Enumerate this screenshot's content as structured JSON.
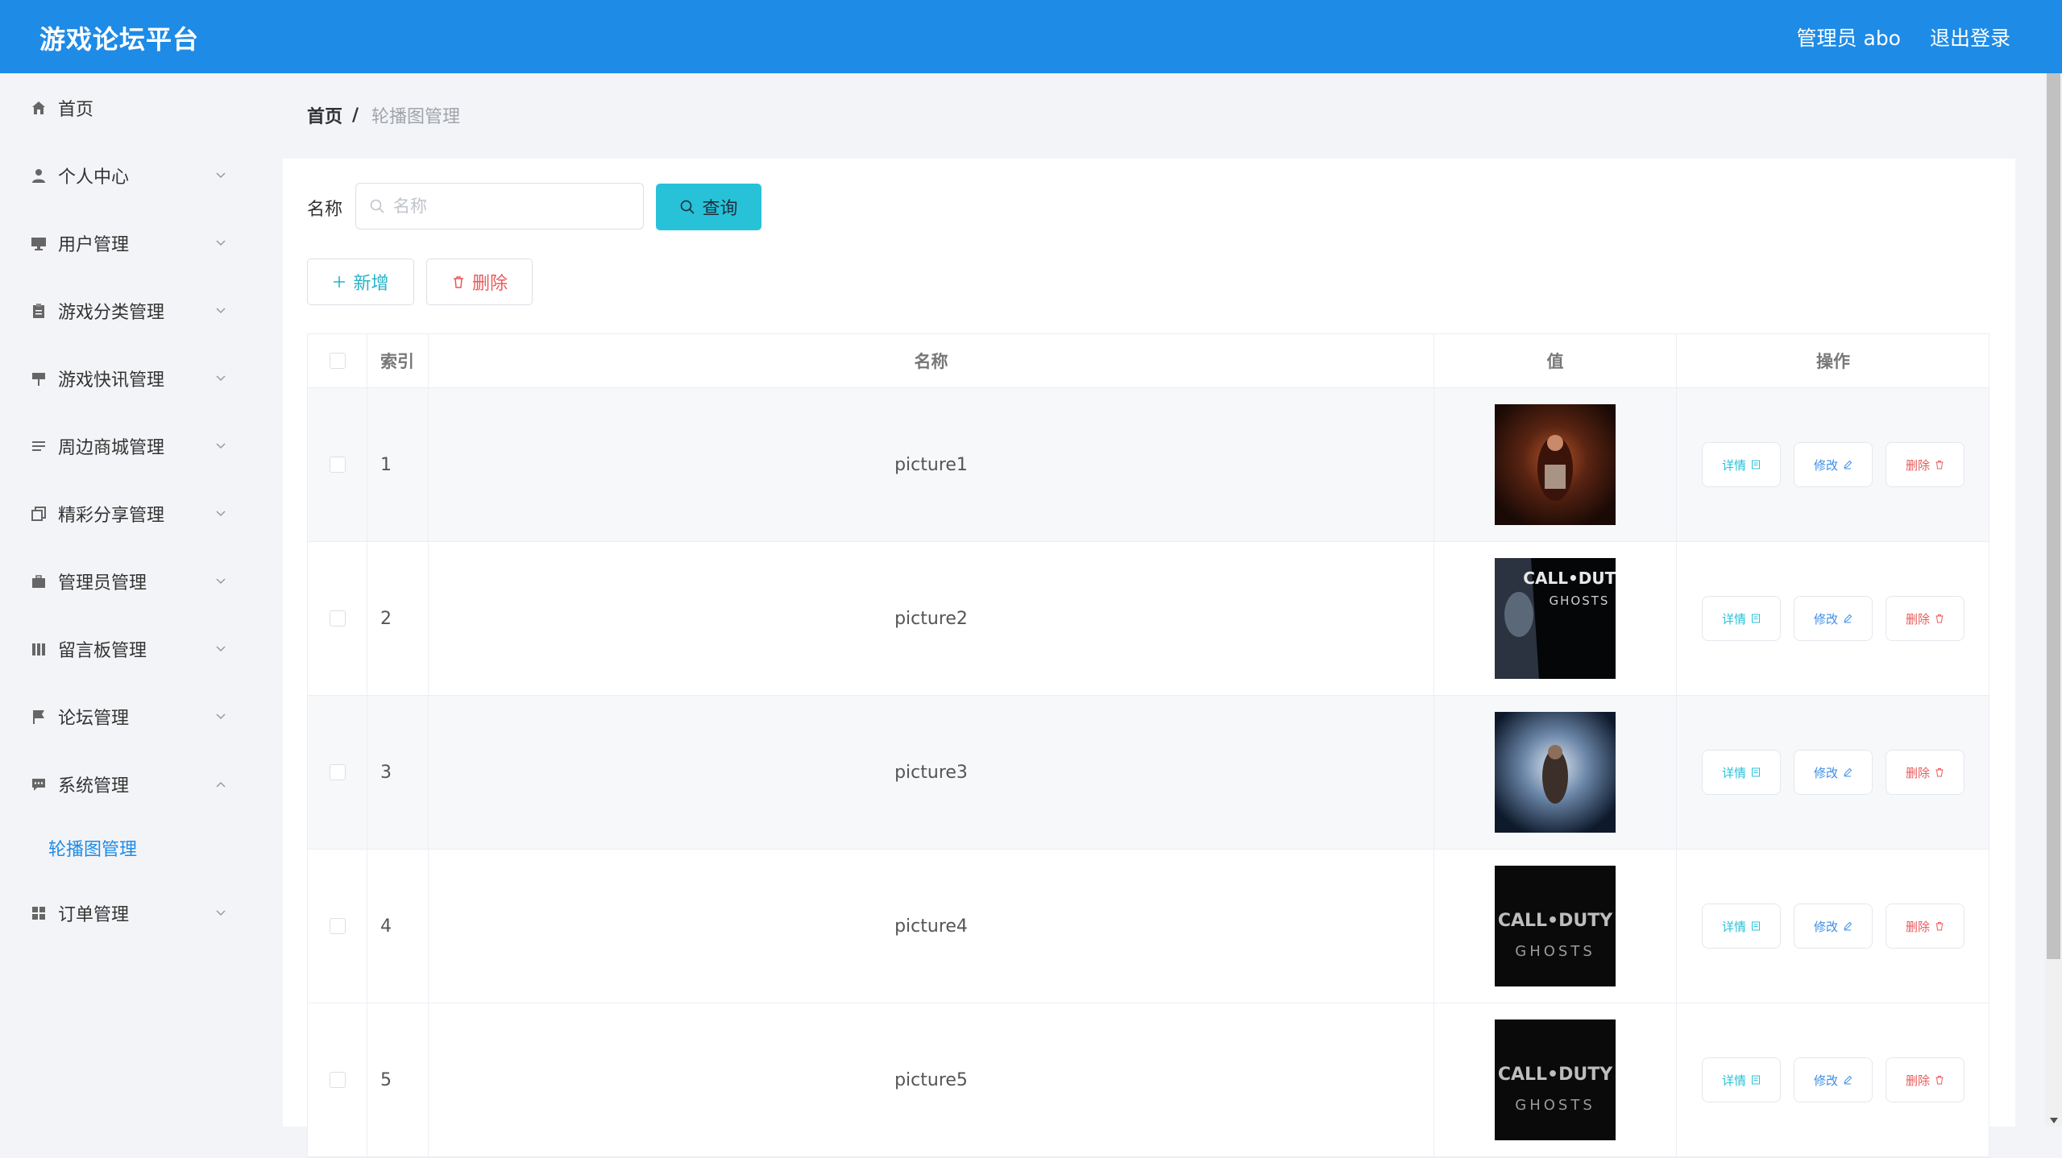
{
  "app": {
    "title": "游戏论坛平台",
    "user_label": "管理员 abo",
    "logout_label": "退出登录"
  },
  "sidebar": {
    "items": [
      {
        "label": "首页",
        "icon": "home-icon"
      },
      {
        "label": "个人中心",
        "icon": "user-icon"
      },
      {
        "label": "用户管理",
        "icon": "monitor-icon"
      },
      {
        "label": "游戏分类管理",
        "icon": "clipboard-icon"
      },
      {
        "label": "游戏快讯管理",
        "icon": "pin-icon"
      },
      {
        "label": "周边商城管理",
        "icon": "list-icon"
      },
      {
        "label": "精彩分享管理",
        "icon": "copy-icon"
      },
      {
        "label": "管理员管理",
        "icon": "briefcase-icon"
      },
      {
        "label": "留言板管理",
        "icon": "bars-icon"
      },
      {
        "label": "论坛管理",
        "icon": "flag-icon"
      },
      {
        "label": "系统管理",
        "icon": "chat-icon"
      },
      {
        "label": "订单管理",
        "icon": "grid-icon"
      }
    ],
    "active_sub": "轮播图管理"
  },
  "breadcrumb": {
    "home": "首页",
    "separator": "/",
    "current": "轮播图管理"
  },
  "search": {
    "label": "名称",
    "placeholder": "名称",
    "value": "",
    "button": "查询"
  },
  "actions": {
    "add": "新增",
    "delete": "删除"
  },
  "table": {
    "headers": [
      "索引",
      "名称",
      "值",
      "操作"
    ],
    "rows": [
      {
        "index": "1",
        "name": "picture1"
      },
      {
        "index": "2",
        "name": "picture2"
      },
      {
        "index": "3",
        "name": "picture3"
      },
      {
        "index": "4",
        "name": "picture4"
      },
      {
        "index": "5",
        "name": "picture5"
      }
    ],
    "op_labels": {
      "detail": "详情",
      "edit": "修改",
      "delete": "删除"
    }
  },
  "thumbnail_texts": {
    "cod_line1": "CALL•DUTY",
    "cod_line2": "GHOSTS"
  },
  "colors": {
    "header": "#1e8be6",
    "accent": "#27c2d8",
    "danger": "#e85a5a",
    "link": "#3a8ee6"
  }
}
